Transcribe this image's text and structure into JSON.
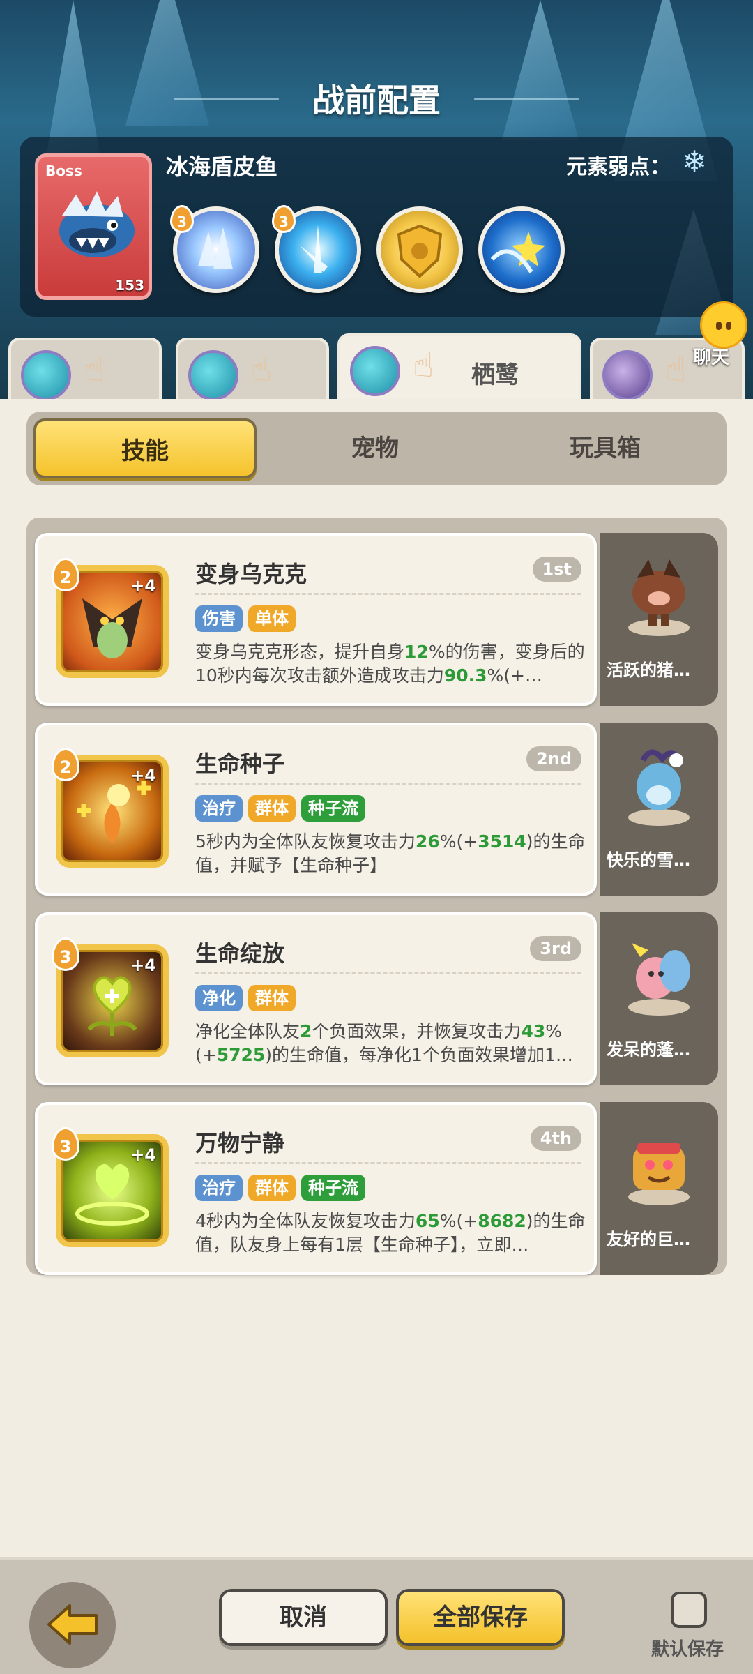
{
  "header": {
    "title": "战前配置"
  },
  "boss": {
    "tag": "Boss",
    "name": "冰海盾皮鱼",
    "level": "153",
    "weakness_label": "元素弱点：",
    "weakness_icon": "snowflake-icon",
    "skills": [
      {
        "badge": "3",
        "icon": "ice-crystal-icon"
      },
      {
        "badge": "3",
        "icon": "ice-splash-icon"
      },
      {
        "badge": "",
        "icon": "golden-shield-icon"
      },
      {
        "badge": "",
        "icon": "water-star-icon"
      }
    ]
  },
  "heroes": [
    {
      "name": "",
      "active": false
    },
    {
      "name": "",
      "active": false
    },
    {
      "name": "栖鹭",
      "active": true
    },
    {
      "name": "",
      "active": false
    }
  ],
  "chat": {
    "label": "聊天"
  },
  "tabs": [
    {
      "label": "技能",
      "active": true
    },
    {
      "label": "宠物",
      "active": false
    },
    {
      "label": "玩具箱",
      "active": false
    }
  ],
  "skills": [
    {
      "level": "2",
      "plus": "+4",
      "title": "变身乌克克",
      "rank": "1st",
      "tags": [
        "伤害",
        "单体"
      ],
      "desc_parts": [
        "变身乌克克形态，提升自身",
        "12",
        "%的伤害，变身后的10秒内每次攻击额外造成攻击力",
        "90.3",
        "%(+…"
      ],
      "pet": "活跃的猪…"
    },
    {
      "level": "2",
      "plus": "+4",
      "title": "生命种子",
      "rank": "2nd",
      "tags": [
        "治疗",
        "群体",
        "种子流"
      ],
      "desc_parts": [
        "5秒内为全体队友恢复攻击力",
        "26",
        "%(+",
        "3514",
        ")的生命值，并赋予【生命种子】"
      ],
      "pet": "快乐的雪…"
    },
    {
      "level": "3",
      "plus": "+4",
      "title": "生命绽放",
      "rank": "3rd",
      "tags": [
        "净化",
        "群体"
      ],
      "desc_parts": [
        "净化全体队友",
        "2",
        "个负面效果，并恢复攻击力",
        "43",
        "%(+",
        "5725",
        ")的生命值，每净化1个负面效果增加1…"
      ],
      "pet": "发呆的蓬…"
    },
    {
      "level": "3",
      "plus": "+4",
      "title": "万物宁静",
      "rank": "4th",
      "tags": [
        "治疗",
        "群体",
        "种子流"
      ],
      "desc_parts": [
        "4秒内为全体队友恢复攻击力",
        "65",
        "%(+",
        "8682",
        ")的生命值，队友身上每有1层【生命种子】，立即…"
      ],
      "pet": "友好的巨…"
    }
  ],
  "footer": {
    "cancel": "取消",
    "save_all": "全部保存",
    "default_save": "默认保存"
  }
}
